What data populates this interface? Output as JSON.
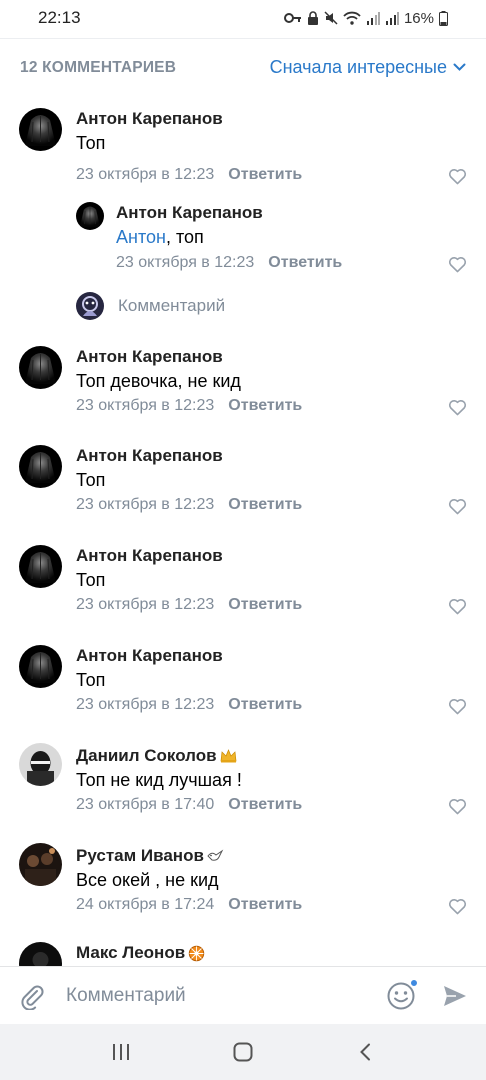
{
  "status_bar": {
    "time": "22:13",
    "battery": "16%"
  },
  "header": {
    "count_label": "12 КОММЕНТАРИЕВ",
    "sort_label": "Сначала интересные"
  },
  "comments": [
    {
      "author": "Антон Карепанов",
      "text": "Топ",
      "date": "23 октября в 12:23",
      "reply_label": "Ответить"
    },
    {
      "author": "Антон Карепанов",
      "mention": "Антон",
      "text": ", топ",
      "date": "23 октября в 12:23",
      "reply_label": "Ответить"
    },
    {
      "author": "Антон Карепанов",
      "text": "Топ девочка, не кид",
      "date": "23 октября в 12:23",
      "reply_label": "Ответить"
    },
    {
      "author": "Антон Карепанов",
      "text": "Топ",
      "date": "23 октября в 12:23",
      "reply_label": "Ответить"
    },
    {
      "author": "Антон Карепанов",
      "text": "Топ",
      "date": "23 октября в 12:23",
      "reply_label": "Ответить"
    },
    {
      "author": "Антон Карепанов",
      "text": "Топ",
      "date": "23 октября в 12:23",
      "reply_label": "Ответить"
    },
    {
      "author": "Даниил Соколов",
      "text": "Топ не кид лучшая !",
      "date": "23 октября в 17:40",
      "reply_label": "Ответить",
      "badge": "crown-icon"
    },
    {
      "author": "Рустам Иванов",
      "text": "Все окей , не кид",
      "date": "24 октября в 17:24",
      "reply_label": "Ответить",
      "badge": "dove-icon"
    },
    {
      "author": "Макс Леонов",
      "badge": "wheel-icon"
    }
  ],
  "reply_compose": {
    "placeholder": "Комментарий"
  },
  "input_bar": {
    "placeholder": "Комментарий"
  },
  "colors": {
    "accent": "#2a79c9",
    "secondary_text": "#818c99"
  }
}
